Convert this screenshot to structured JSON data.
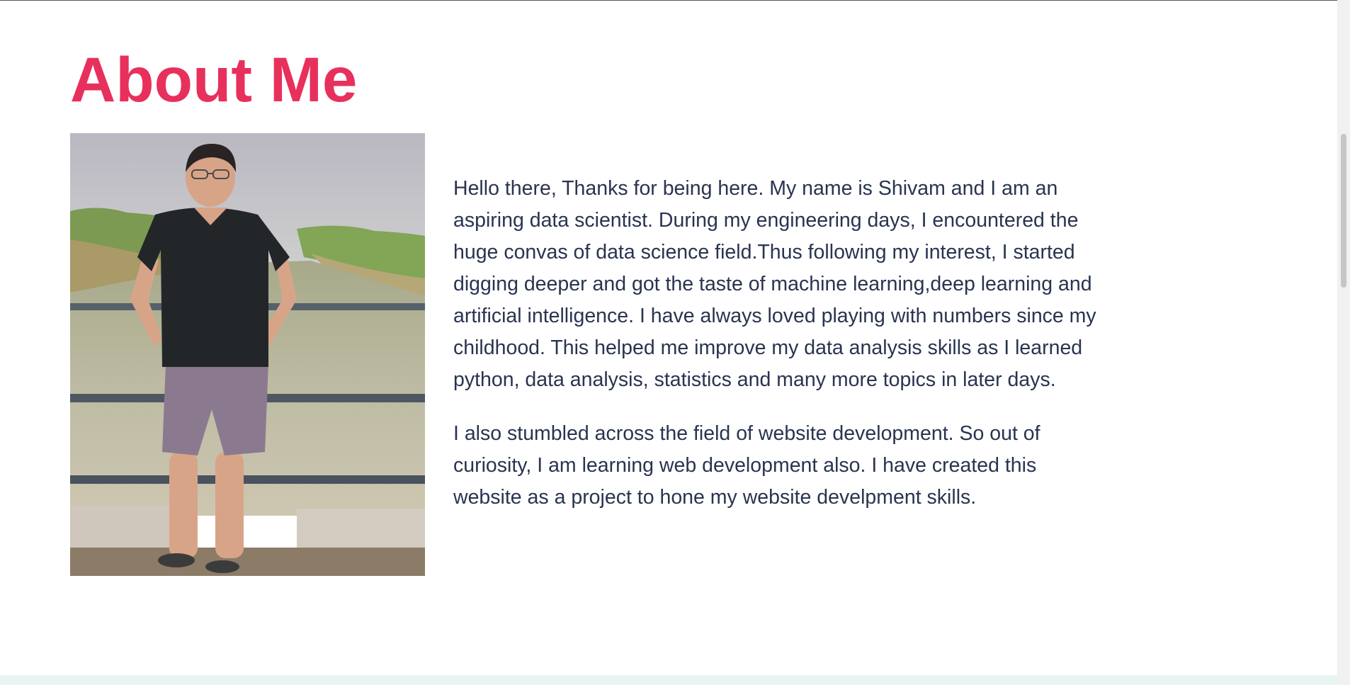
{
  "about": {
    "title": "About Me",
    "photo_alt": "Portrait photo standing in front of a canal",
    "paragraphs": [
      "Hello there, Thanks for being here. My name is Shivam and I am an aspiring data scientist. During my engineering days, I encountered the huge convas of data science field.Thus following my interest, I started digging deeper and got the taste of machine learning,deep learning and artificial intelligence. I have always loved playing with numbers since my childhood. This helped me improve my data analysis skills as I learned python, data analysis, statistics and many more topics in later days.",
      "I also stumbled across the field of website development. So out of curiosity, I am learning web development also. I have created this website as a project to hone my website develpment skills."
    ]
  },
  "colors": {
    "title": "#e8305c",
    "body_text": "#2a3450",
    "footer_strip": "#e7f4f2"
  }
}
